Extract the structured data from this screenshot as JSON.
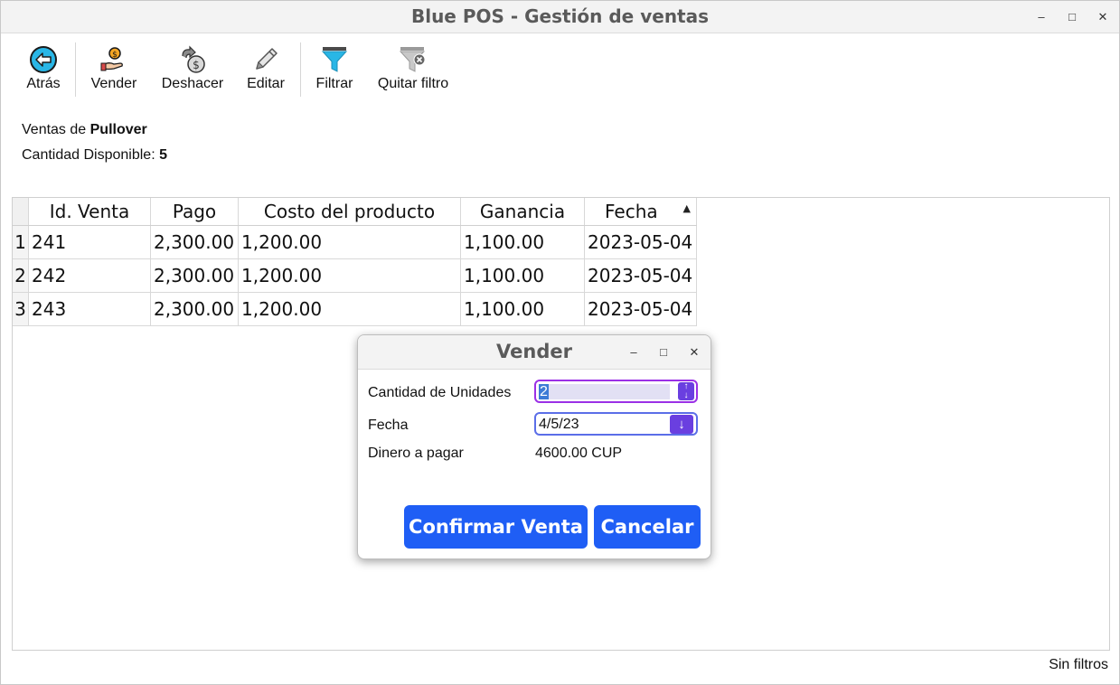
{
  "window": {
    "title": "Blue POS - Gestión de ventas",
    "minimize": "–",
    "maximize": "□",
    "close": "✕"
  },
  "toolbar": {
    "back": "Atrás",
    "sell": "Vender",
    "undo": "Deshacer",
    "edit": "Editar",
    "filter": "Filtrar",
    "clear_filter": "Quitar filtro"
  },
  "info": {
    "sales_of_label": "Ventas de ",
    "product": "Pullover",
    "available_label": "Cantidad Disponible: ",
    "available": "5"
  },
  "table": {
    "columns": [
      "Id. Venta",
      "Pago",
      "Costo del producto",
      "Ganancia",
      "Fecha"
    ],
    "rows": [
      {
        "num": "1",
        "cells": [
          "241",
          "2,300.00",
          "1,200.00",
          "1,100.00",
          "2023-05-04"
        ]
      },
      {
        "num": "2",
        "cells": [
          "242",
          "2,300.00",
          "1,200.00",
          "1,100.00",
          "2023-05-04"
        ]
      },
      {
        "num": "3",
        "cells": [
          "243",
          "2,300.00",
          "1,200.00",
          "1,100.00",
          "2023-05-04"
        ]
      }
    ],
    "sort_indicator": "▲"
  },
  "status": {
    "text": "Sin filtros"
  },
  "dialog": {
    "title": "Vender",
    "minimize": "–",
    "maximize": "□",
    "close": "✕",
    "units_label": "Cantidad de Unidades",
    "units_value": "2",
    "date_label": "Fecha",
    "date_value": "4/5/23",
    "pay_label": "Dinero a pagar",
    "pay_value": "4600.00 CUP",
    "confirm": "Confirmar Venta",
    "cancel": "Cancelar"
  },
  "colors": {
    "accent": "#1f5ef5",
    "focus": "#9b30e6",
    "spin": "#6a3fe0",
    "filter_icon": "#29b6e6"
  },
  "icons": [
    "back-arrow-icon",
    "sell-hand-coin-icon",
    "undo-coin-icon",
    "pencil-icon",
    "funnel-icon",
    "funnel-clear-icon"
  ]
}
